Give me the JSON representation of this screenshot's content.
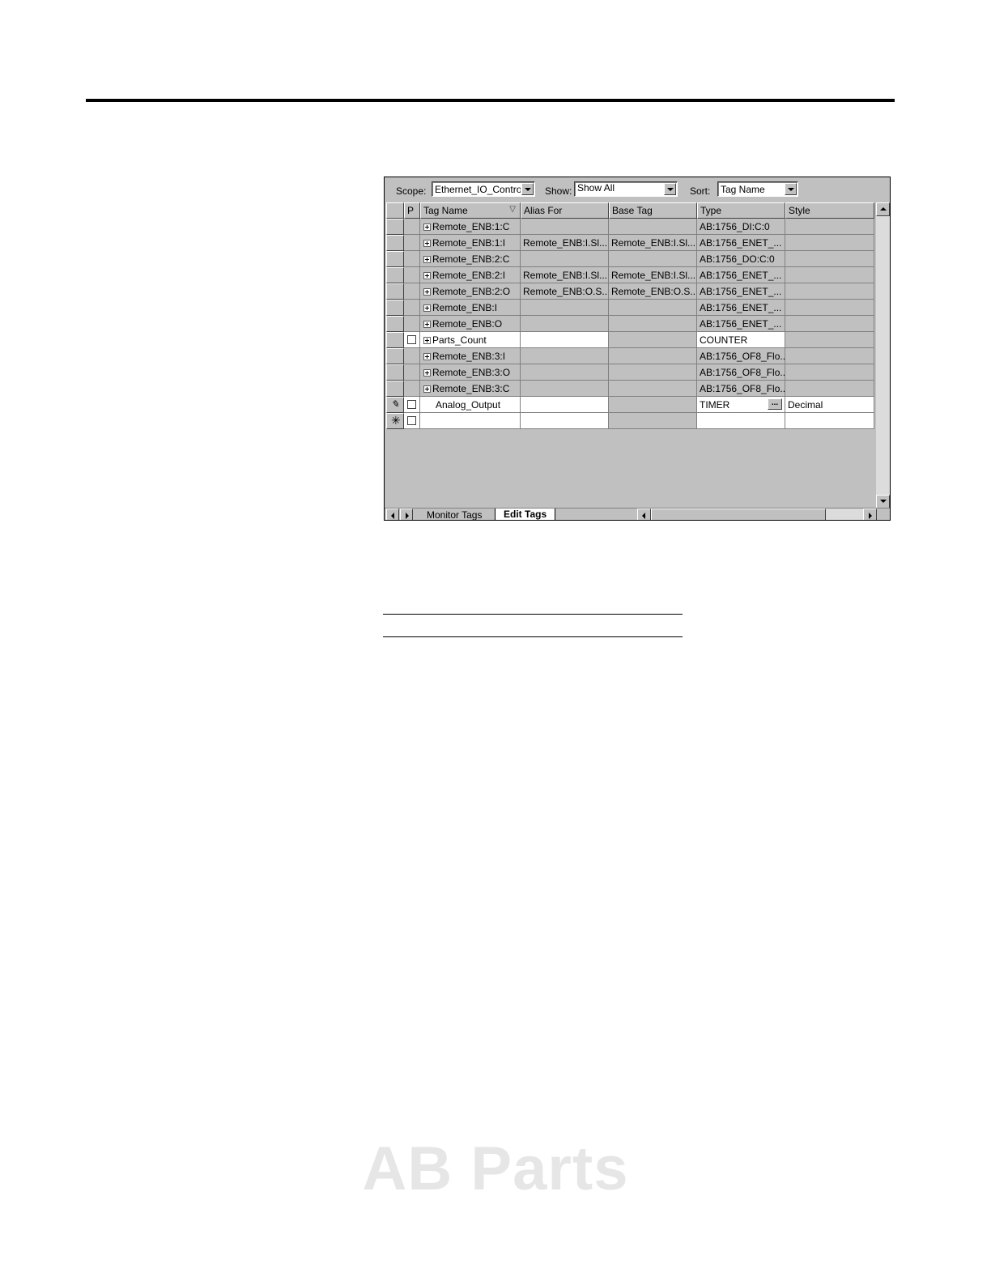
{
  "toolbar": {
    "scope_label": "Scope:",
    "scope_value": "Ethernet_IO_Control",
    "show_label": "Show:",
    "show_value": "Show All",
    "sort_label": "Sort:",
    "sort_value": "Tag Name"
  },
  "columns": {
    "p": "P",
    "tag_name": "Tag Name",
    "alias_for": "Alias For",
    "base_tag": "Base Tag",
    "type": "Type",
    "style": "Style"
  },
  "rows": [
    {
      "tag": "Remote_ENB:1:C",
      "alias": "",
      "base": "",
      "type": "AB:1756_DI:C:0",
      "style": ""
    },
    {
      "tag": "Remote_ENB:1:I",
      "alias": "Remote_ENB:I.Sl...",
      "base": "Remote_ENB:I.Sl...",
      "type": "AB:1756_ENET_...",
      "style": ""
    },
    {
      "tag": "Remote_ENB:2:C",
      "alias": "",
      "base": "",
      "type": "AB:1756_DO:C:0",
      "style": ""
    },
    {
      "tag": "Remote_ENB:2:I",
      "alias": "Remote_ENB:I.Sl...",
      "base": "Remote_ENB:I.Sl...",
      "type": "AB:1756_ENET_...",
      "style": ""
    },
    {
      "tag": "Remote_ENB:2:O",
      "alias": "Remote_ENB:O.S...",
      "base": "Remote_ENB:O.S...",
      "type": "AB:1756_ENET_...",
      "style": ""
    },
    {
      "tag": "Remote_ENB:I",
      "alias": "",
      "base": "",
      "type": "AB:1756_ENET_...",
      "style": ""
    },
    {
      "tag": "Remote_ENB:O",
      "alias": "",
      "base": "",
      "type": "AB:1756_ENET_...",
      "style": ""
    },
    {
      "tag": "Parts_Count",
      "alias": "",
      "base": "",
      "type": "COUNTER",
      "style": ""
    },
    {
      "tag": "Remote_ENB:3:I",
      "alias": "",
      "base": "",
      "type": "AB:1756_OF8_Flo...",
      "style": ""
    },
    {
      "tag": "Remote_ENB:3:O",
      "alias": "",
      "base": "",
      "type": "AB:1756_OF8_Flo...",
      "style": ""
    },
    {
      "tag": "Remote_ENB:3:C",
      "alias": "",
      "base": "",
      "type": "AB:1756_OF8_Flo...",
      "style": ""
    },
    {
      "tag": "Analog_Output",
      "alias": "",
      "base": "",
      "type": "TIMER",
      "style": "Decimal"
    },
    {
      "tag": "",
      "alias": "",
      "base": "",
      "type": "",
      "style": ""
    }
  ],
  "edit_row_button": "...",
  "tabs": {
    "monitor": "Monitor Tags",
    "edit": "Edit Tags"
  },
  "watermark": "AB Parts"
}
